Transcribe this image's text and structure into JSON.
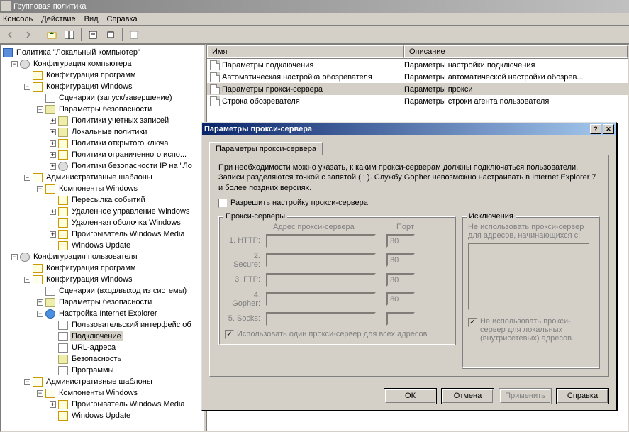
{
  "window": {
    "title": "Групповая политика"
  },
  "menu": {
    "console": "Консоль",
    "action": "Действие",
    "view": "Вид",
    "help": "Справка"
  },
  "tree": {
    "root": "Политика \"Локальный компьютер\"",
    "comp_config": "Конфигурация компьютера",
    "prog_config": "Конфигурация программ",
    "win_config": "Конфигурация Windows",
    "scenarios": "Сценарии (запуск/завершение)",
    "sec_params": "Параметры безопасности",
    "acct_policies": "Политики учетных записей",
    "local_policies": "Локальные политики",
    "pubkey_policies": "Политики открытого ключа",
    "restricted": "Политики ограниченного испо...",
    "ipsec": "Политики безопасности IP на \"Ло",
    "admin_templates": "Административные шаблоны",
    "win_components": "Компоненты Windows",
    "event_fwd": "Пересылка событий",
    "remote_mgmt": "Удаленное управление Windows",
    "remote_shell": "Удаленная оболочка Windows",
    "wmp": "Проигрыватель Windows Media",
    "wu": "Windows Update",
    "user_config": "Конфигурация пользователя",
    "prog_config2": "Конфигурация программ",
    "win_config2": "Конфигурация Windows",
    "logon_scripts": "Сценарии (вход/выход из системы)",
    "sec_params2": "Параметры безопасности",
    "ie_settings": "Настройка Internet Explorer",
    "ui": "Пользовательский интерфейс об",
    "connection": "Подключение",
    "url": "URL-адреса",
    "security": "Безопасность",
    "programs": "Программы",
    "admin_templates2": "Административные шаблоны",
    "win_components2": "Компоненты Windows",
    "wmp2": "Проигрыватель Windows Media",
    "wu2": "Windows Update"
  },
  "list": {
    "col_name": "Имя",
    "col_desc": "Описание",
    "rows": [
      {
        "name": "Параметры подключения",
        "desc": "Параметры настройки подключения"
      },
      {
        "name": "Автоматическая настройка обозревателя",
        "desc": "Параметры автоматической настройки обозрев..."
      },
      {
        "name": "Параметры прокси-сервера",
        "desc": "Параметры прокси"
      },
      {
        "name": "Строка обозревателя",
        "desc": "Параметры строки агента пользователя"
      }
    ]
  },
  "dialog": {
    "title": "Параметры прокси-сервера",
    "tab": "Параметры прокси-сервера",
    "info": "При необходимости можно указать, к каким прокси-серверам должны подключаться пользователи. Записи разделяются точкой с запятой ( ; ). Службу Gopher невозможно настраивать в Internet Explorer 7 и более поздних версиях.",
    "allow": "Разрешить настройку прокси-сервера",
    "proxy_legend": "Прокси-серверы",
    "addr_header": "Адрес прокси-сервера",
    "port_header": "Порт",
    "http": "1. HTTP:",
    "secure": "2. Secure:",
    "ftp": "3. FTP:",
    "gopher": "4. Gopher:",
    "socks": "5. Socks:",
    "port_default": "80",
    "use_same": "Использовать один прокси-сервер для всех адресов",
    "excl_legend": "Исключения",
    "excl_text": "Не использовать прокси-сервер для адресов, начинающихся с:",
    "excl_local": "Не использовать прокси-сервер для локальных (внутрисетевых) адресов.",
    "ok": "ОК",
    "cancel": "Отмена",
    "apply": "Применить",
    "help": "Справка"
  }
}
